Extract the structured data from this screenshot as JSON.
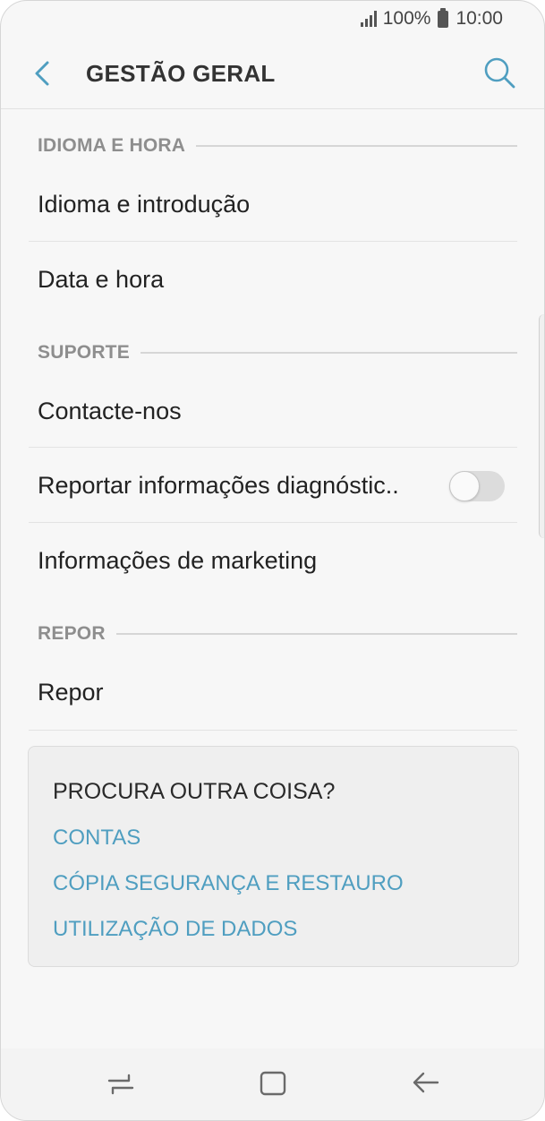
{
  "status_bar": {
    "battery": "100%",
    "time": "10:00"
  },
  "app_bar": {
    "title": "GESTÃO GERAL",
    "back_icon": "chevron-left-icon",
    "search_icon": "search-icon"
  },
  "sections": {
    "idioma_hora": {
      "header": "IDIOMA E HORA",
      "items": [
        "Idioma e introdução",
        "Data e hora"
      ]
    },
    "suporte": {
      "header": "SUPORTE",
      "items": [
        "Contacte-nos",
        "Reportar informações diagnóstic..",
        "Informações de marketing"
      ]
    },
    "repor": {
      "header": "REPOR",
      "items": [
        "Repor"
      ]
    }
  },
  "diagnostics_toggle": {
    "on": false
  },
  "suggestions": {
    "title": "PROCURA OUTRA COISA?",
    "links": [
      "CONTAS",
      "CÓPIA SEGURANÇA E RESTAURO",
      "UTILIZAÇÃO DE DADOS"
    ]
  },
  "colors": {
    "accent": "#4f9ec0",
    "background": "#f7f7f7",
    "section_label": "#8e8e8e"
  },
  "nav_bar": {
    "icons": [
      "recents-icon",
      "home-icon",
      "back-arrow-icon"
    ]
  }
}
